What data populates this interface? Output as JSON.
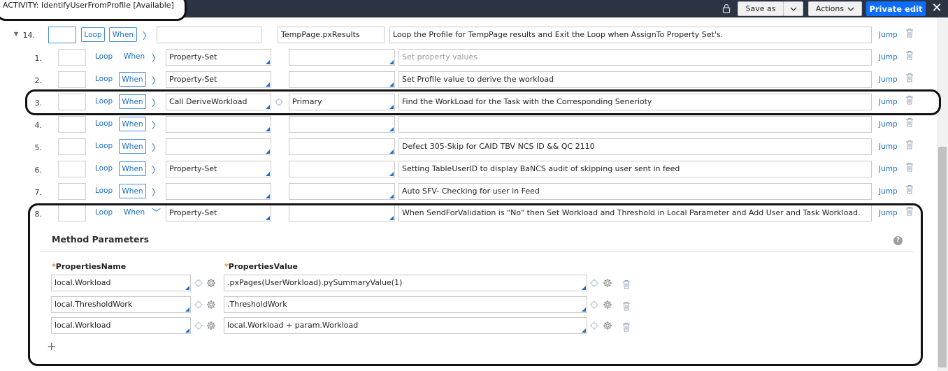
{
  "titlebar": {
    "title": "ACTIVITY: IdentifyUserFromProfile [Available]",
    "save_as": "Save as",
    "actions": "Actions",
    "private_edit": "Private edit"
  },
  "steps": [
    {
      "num": "14.",
      "collapsed_marker": "▼",
      "loop": "Loop",
      "when": "When",
      "method": "",
      "step_page": "TempPage.pxResults",
      "description": "Loop the Profile for TempPage results and Exit the Loop when AssignTo Property Set's.",
      "jump": "Jump"
    },
    {
      "num": "1.",
      "loop": "Loop",
      "when": "When",
      "method": "Property-Set",
      "step_page": "",
      "description": "Set property values",
      "description_is_placeholder": true,
      "jump": "Jump"
    },
    {
      "num": "2.",
      "loop": "Loop",
      "when": "When",
      "method": "Property-Set",
      "step_page": "",
      "description": "Set Profile value to derive the workload",
      "jump": "Jump"
    },
    {
      "num": "3.",
      "loop": "Loop",
      "when": "When",
      "method": "Call DeriveWorkload",
      "step_page": "Primary",
      "description": "Find the WorkLoad for the Task with the Corresponding Senerioty",
      "jump": "Jump"
    },
    {
      "num": "4.",
      "loop": "Loop",
      "when": "When",
      "method": "",
      "step_page": "",
      "description": "",
      "jump": "Jump"
    },
    {
      "num": "5.",
      "loop": "Loop",
      "when": "When",
      "method": "",
      "step_page": "",
      "description": "Defect 305-Skip for CAID TBV NCS ID && QC 2110",
      "jump": "Jump"
    },
    {
      "num": "6.",
      "loop": "Loop",
      "when": "When",
      "method": "Property-Set",
      "step_page": "",
      "description": "Setting TableUserID to display BaNCS audit of skipping user sent in feed",
      "jump": "Jump"
    },
    {
      "num": "7.",
      "loop": "Loop",
      "when": "When",
      "method": "",
      "step_page": "",
      "description": "Auto SFV- Checking for user in Feed",
      "jump": "Jump"
    },
    {
      "num": "8.",
      "loop": "Loop",
      "when": "When",
      "method": "Property-Set",
      "step_page": "",
      "description": "When SendForValidation is \"No\" then Set Workload and Threshold in Local Parameter and Add User and Task Workload.",
      "jump": "Jump"
    }
  ],
  "method_parameters": {
    "title": "Method Parameters",
    "col_name": "PropertiesName",
    "col_value": "PropertiesValue",
    "required_mark": "*",
    "rows": [
      {
        "name": "local.Workload",
        "value": ".pxPages(UserWorkload).pySummaryValue(1)"
      },
      {
        "name": "local.ThresholdWork",
        "value": ".ThresholdWork"
      },
      {
        "name": "local.Workload",
        "value": "local.Workload + param.Workload"
      }
    ]
  },
  "colors": {
    "accent": "#1a6fc7",
    "primary_button": "#0d6efd",
    "titlebar": "#2b3443"
  },
  "icons": [
    "lock-icon",
    "chevron-down-icon",
    "close-icon",
    "chevron-right-icon",
    "trash-icon",
    "target-icon",
    "gear-icon",
    "help-icon",
    "plus-icon"
  ]
}
